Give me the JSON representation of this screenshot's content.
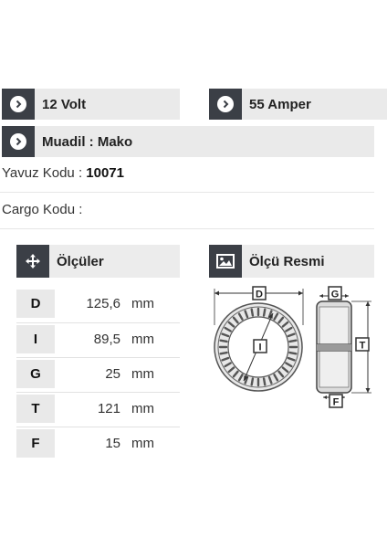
{
  "specs": {
    "voltage": "12 Volt",
    "amperage": "55 Amper",
    "equivalent": "Muadil : Mako"
  },
  "codes": {
    "yavuz_label": "Yavuz Kodu : ",
    "yavuz_value": "10071",
    "cargo_label": "Cargo Kodu :"
  },
  "dimensions": {
    "title": "Ölçüler",
    "rows": [
      {
        "key": "D",
        "value": "125,6",
        "unit": "mm"
      },
      {
        "key": "I",
        "value": "89,5",
        "unit": "mm"
      },
      {
        "key": "G",
        "value": "25",
        "unit": "mm"
      },
      {
        "key": "T",
        "value": "121",
        "unit": "mm"
      },
      {
        "key": "F",
        "value": "15",
        "unit": "mm"
      }
    ]
  },
  "drawing": {
    "title": "Ölçü Resmi",
    "labels": {
      "D": "D",
      "I": "I",
      "G": "G",
      "T": "T",
      "F": "F"
    }
  },
  "icons": {
    "bullet": "chevron-right-circle-icon",
    "dimensions": "move-arrows-icon",
    "drawing": "image-icon"
  },
  "colors": {
    "icon_bg": "#3b3f46",
    "bar_bg": "#eaeaea"
  }
}
